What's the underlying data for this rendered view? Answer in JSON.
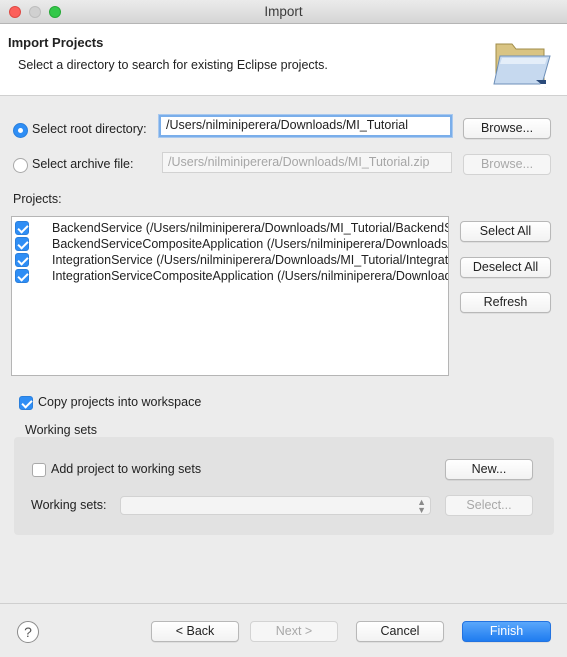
{
  "window": {
    "title": "Import"
  },
  "header": {
    "title": "Import Projects",
    "description": "Select a directory to search for existing Eclipse projects."
  },
  "source": {
    "root_label": "Select root directory:",
    "root_value": "/Users/nilminiperera/Downloads/MI_Tutorial",
    "root_selected": true,
    "archive_label": "Select archive file:",
    "archive_value": "/Users/nilminiperera/Downloads/MI_Tutorial.zip",
    "browse_label": "Browse..."
  },
  "projects": {
    "label": "Projects:",
    "items": [
      {
        "text": "BackendService (/Users/nilminiperera/Downloads/MI_Tutorial/BackendService)",
        "checked": true
      },
      {
        "text": "BackendServiceCompositeApplication (/Users/nilminiperera/Downloads/MI_Tutorial/BackendServiceCompositeApplication)",
        "checked": true
      },
      {
        "text": "IntegrationService (/Users/nilminiperera/Downloads/MI_Tutorial/IntegrationService)",
        "checked": true
      },
      {
        "text": "IntegrationServiceCompositeApplication (/Users/nilminiperera/Downloads/MI_Tutorial/IntegrationServiceCompositeApplication)",
        "checked": true
      }
    ],
    "select_all_label": "Select All",
    "deselect_all_label": "Deselect All",
    "refresh_label": "Refresh"
  },
  "options": {
    "copy_label": "Copy projects into workspace",
    "copy_checked": true
  },
  "working_sets": {
    "group_label": "Working sets",
    "add_label": "Add project to working sets",
    "add_checked": false,
    "new_label": "New...",
    "field_label": "Working sets:",
    "select_label": "Select..."
  },
  "footer": {
    "help_glyph": "?",
    "back_label": "< Back",
    "next_label": "Next >",
    "cancel_label": "Cancel",
    "finish_label": "Finish"
  },
  "colors": {
    "accent": "#2f8ef5",
    "primary_button": "#1f7cf0"
  },
  "icons": {
    "header": "folder-open-icon",
    "help": "help-icon"
  }
}
